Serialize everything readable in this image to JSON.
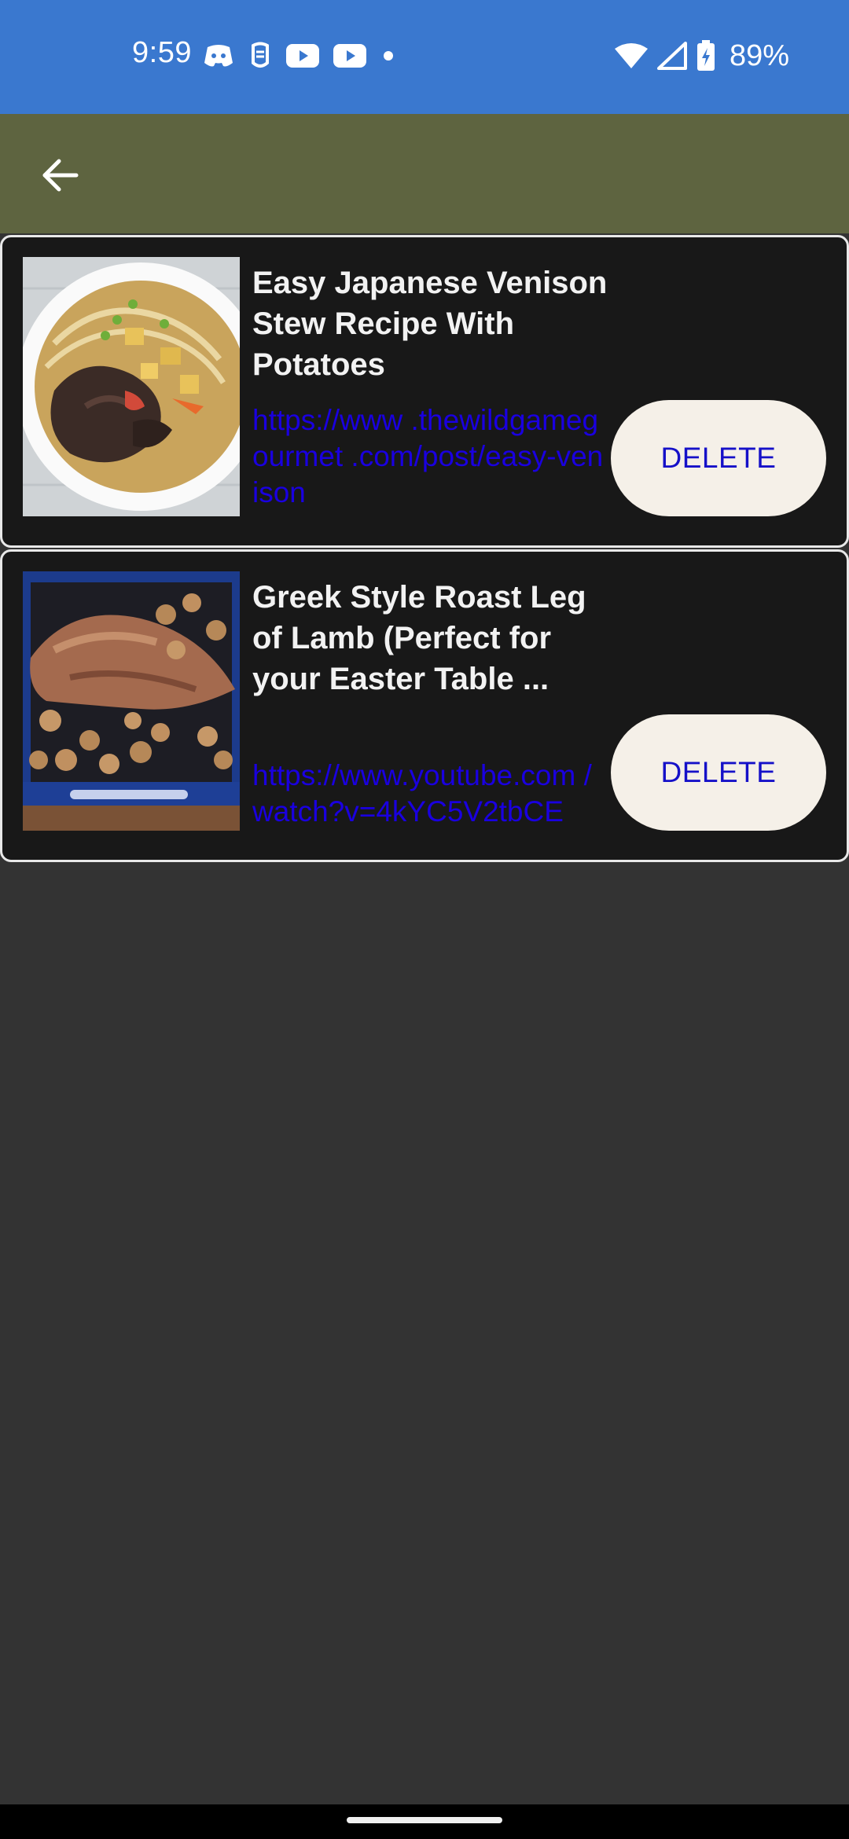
{
  "status_bar": {
    "time": "9:59",
    "battery_percent": "89%",
    "icons": [
      "discord-icon",
      "hand-icon",
      "youtube-icon",
      "youtube-icon",
      "dot-icon",
      "wifi-icon",
      "signal-icon",
      "battery-charging-icon"
    ]
  },
  "app_bar": {
    "back_icon": "arrow-left-icon",
    "color": "#5e6440"
  },
  "recipes": [
    {
      "title": "Easy Japanese Venison Stew Recipe With Potatoes",
      "url": "https://www .thewildgamegourmet .com/post/easy-venison",
      "delete_label": "DELETE",
      "thumbnail": "venison-stew-image"
    },
    {
      "title": "Greek Style Roast Leg of Lamb (Perfect for your Easter Table ...",
      "url": "https://www.youtube.com /watch?v=4kYC5V2tbCE",
      "delete_label": "DELETE",
      "thumbnail": "roast-lamb-image"
    }
  ],
  "colors": {
    "status_bar": "#3a78cf",
    "background": "#333333",
    "card": "#181818",
    "link": "#1a00e0",
    "button": "#f5f0e8"
  }
}
